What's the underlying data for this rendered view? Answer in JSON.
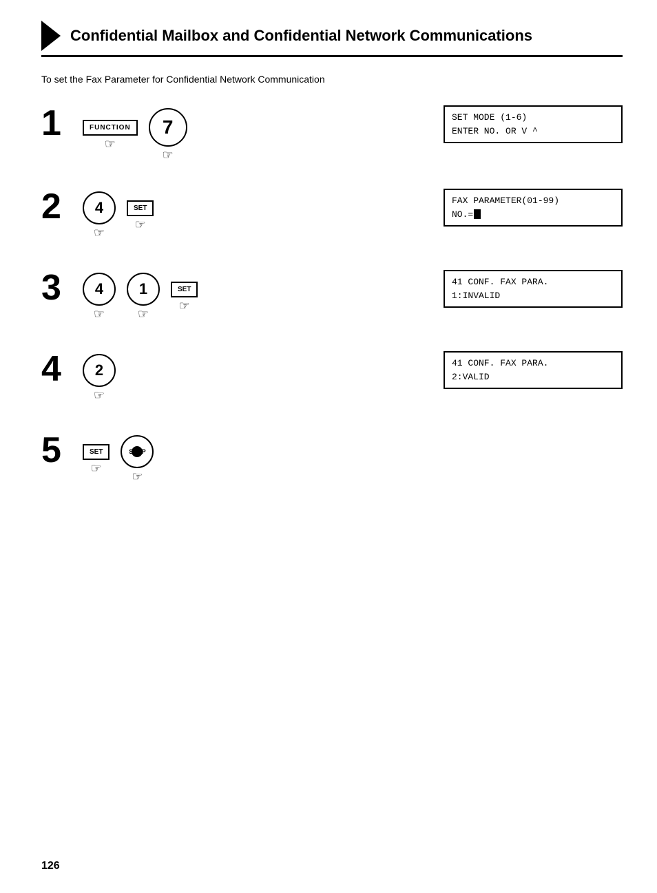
{
  "header": {
    "title": "Confidential Mailbox and Confidential Network Communications"
  },
  "intro": {
    "text": "To set the Fax Parameter for Confidential Network Communication"
  },
  "steps": [
    {
      "number": "1",
      "actions": [
        {
          "type": "function-btn",
          "label": "FUNCTION"
        },
        {
          "type": "circle-large",
          "label": "7"
        }
      ],
      "display": {
        "lines": [
          "SET MODE        (1-6)",
          "ENTER NO. OR  V ^"
        ]
      }
    },
    {
      "number": "2",
      "actions": [
        {
          "type": "circle",
          "label": "4"
        },
        {
          "type": "set-btn",
          "label": "SET"
        }
      ],
      "display": {
        "lines": [
          "FAX PARAMETER(01-99)",
          "NO.=█"
        ]
      }
    },
    {
      "number": "3",
      "actions": [
        {
          "type": "circle",
          "label": "4"
        },
        {
          "type": "circle",
          "label": "1"
        },
        {
          "type": "set-btn",
          "label": "SET"
        }
      ],
      "display": {
        "lines": [
          "41 CONF. FAX PARA.",
          "1:INVALID"
        ]
      }
    },
    {
      "number": "4",
      "actions": [
        {
          "type": "circle",
          "label": "2"
        }
      ],
      "display": {
        "lines": [
          "41 CONF. FAX PARA.",
          "2:VALID"
        ]
      }
    },
    {
      "number": "5",
      "actions": [
        {
          "type": "set-btn",
          "label": "SET"
        },
        {
          "type": "stop-btn",
          "label": "STOP"
        }
      ],
      "display": null
    }
  ],
  "page_number": "126"
}
